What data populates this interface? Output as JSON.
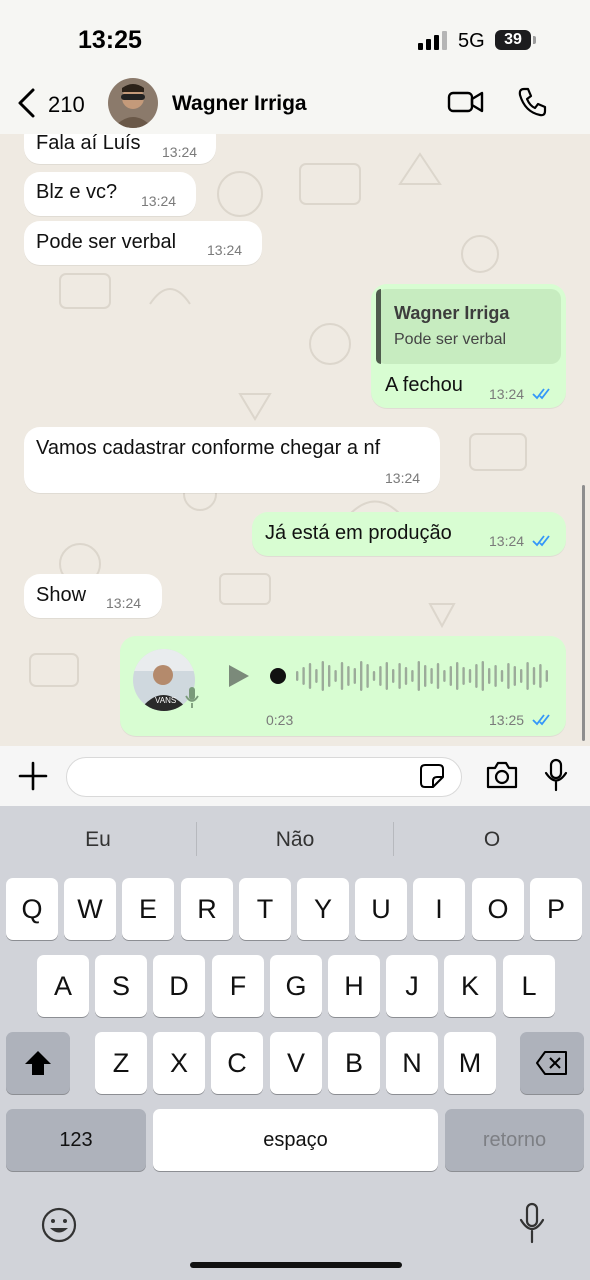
{
  "status_bar": {
    "time": "13:25",
    "network": "5G",
    "battery": "39"
  },
  "header": {
    "back_count": "210",
    "contact_name": "Wagner Irriga"
  },
  "messages": [
    {
      "direction": "in",
      "text": "Fala aí Luís",
      "time": "13:24"
    },
    {
      "direction": "in",
      "text": "Blz e vc?",
      "time": "13:24"
    },
    {
      "direction": "in",
      "text": "Pode ser verbal",
      "time": "13:24"
    },
    {
      "direction": "out",
      "reply_to": {
        "name": "Wagner Irriga",
        "text": "Pode ser verbal"
      },
      "text": "A fechou",
      "time": "13:24",
      "read": true
    },
    {
      "direction": "in",
      "text": "Vamos cadastrar conforme  chegar a nf",
      "time": "13:24"
    },
    {
      "direction": "out",
      "text": "Já está em produção",
      "time": "13:24",
      "read": true
    },
    {
      "direction": "in",
      "text": "Show",
      "time": "13:24"
    },
    {
      "direction": "out",
      "type": "voice",
      "duration": "0:23",
      "time": "13:25",
      "read": true
    }
  ],
  "keyboard": {
    "suggestions": [
      "Eu",
      "Não",
      "O"
    ],
    "row1": [
      "Q",
      "W",
      "E",
      "R",
      "T",
      "Y",
      "U",
      "I",
      "O",
      "P"
    ],
    "row2": [
      "A",
      "S",
      "D",
      "F",
      "G",
      "H",
      "J",
      "K",
      "L"
    ],
    "row3": [
      "Z",
      "X",
      "C",
      "V",
      "B",
      "N",
      "M"
    ],
    "numbers_key": "123",
    "space_key": "espaço",
    "return_key": "retorno"
  },
  "colors": {
    "outgoing_bubble": "#d8fdd2",
    "incoming_bubble": "#ffffff",
    "chat_bg": "#efeae2",
    "read_ticks": "#3497f9"
  }
}
